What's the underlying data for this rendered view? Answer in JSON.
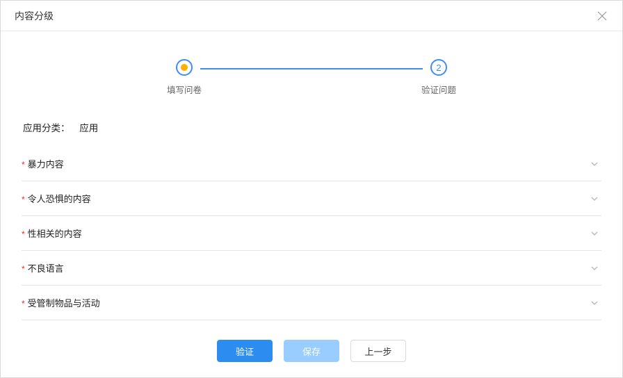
{
  "modal": {
    "title": "内容分级"
  },
  "steps": {
    "step1_label": "填写问卷",
    "step2_label": "验证问题",
    "step2_num": "2"
  },
  "classification": {
    "label": "应用分类：",
    "value": "应用"
  },
  "sections": [
    {
      "title": "暴力内容"
    },
    {
      "title": "令人恐惧的内容"
    },
    {
      "title": "性相关的内容"
    },
    {
      "title": "不良语言"
    },
    {
      "title": "受管制物品与活动"
    }
  ],
  "buttons": {
    "verify": "验证",
    "save": "保存",
    "prev": "上一步"
  }
}
